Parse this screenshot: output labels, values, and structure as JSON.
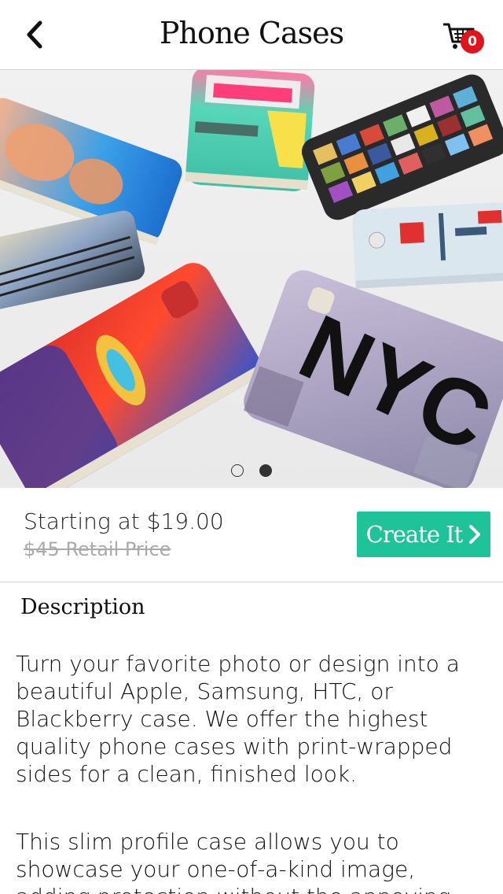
{
  "header": {
    "title": "Phone Cases",
    "cart_count": "0",
    "back_icon": "chevron-left-icon",
    "cart_icon": "shopping-cart-icon"
  },
  "carousel": {
    "slide_count": 2,
    "active_index": 1
  },
  "product": {
    "price_text": "Starting at $19.00",
    "retail_text": "$45 Retail Price",
    "cta_label": "Create It",
    "cta_icon": "chevron-right-icon"
  },
  "description": {
    "heading": "Description",
    "paragraphs": [
      "Turn your favorite photo or design into a beautiful Apple, Samsung, HTC, or Blackberry case. We offer the highest quality phone cases with print-wrapped sides for a clean, finished look.",
      "This slim profile case allows you to showcase your one-of-a-kind image, adding protection without the annoying bulk."
    ]
  },
  "hero_case_text": "NYC",
  "colors": {
    "accent": "#1ec39a",
    "badge": "#e0151b",
    "divider": "#d6d6d6",
    "muted": "#aaaaaa"
  }
}
